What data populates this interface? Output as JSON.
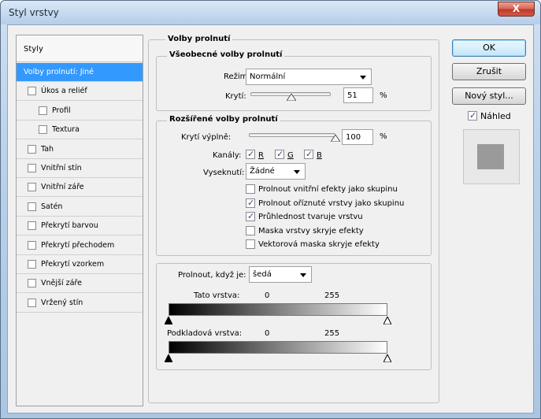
{
  "window": {
    "title": "Styl vrstvy",
    "close_label": "X"
  },
  "styles_panel": {
    "header": "Styly",
    "items": [
      {
        "label": "Volby prolnutí: Jiné",
        "checkbox": false,
        "checked": false,
        "selected": true,
        "indent": 0
      },
      {
        "label": "Úkos a reliéf",
        "checkbox": true,
        "checked": false,
        "selected": false,
        "indent": 0
      },
      {
        "label": "Profil",
        "checkbox": true,
        "checked": false,
        "selected": false,
        "indent": 1
      },
      {
        "label": "Textura",
        "checkbox": true,
        "checked": false,
        "selected": false,
        "indent": 1
      },
      {
        "label": "Tah",
        "checkbox": true,
        "checked": false,
        "selected": false,
        "indent": 0
      },
      {
        "label": "Vnitřní stín",
        "checkbox": true,
        "checked": false,
        "selected": false,
        "indent": 0
      },
      {
        "label": "Vnitřní záře",
        "checkbox": true,
        "checked": false,
        "selected": false,
        "indent": 0
      },
      {
        "label": "Satén",
        "checkbox": true,
        "checked": false,
        "selected": false,
        "indent": 0
      },
      {
        "label": "Překrytí barvou",
        "checkbox": true,
        "checked": false,
        "selected": false,
        "indent": 0
      },
      {
        "label": "Překrytí přechodem",
        "checkbox": true,
        "checked": false,
        "selected": false,
        "indent": 0
      },
      {
        "label": "Překrytí vzorkem",
        "checkbox": true,
        "checked": false,
        "selected": false,
        "indent": 0
      },
      {
        "label": "Vnější záře",
        "checkbox": true,
        "checked": false,
        "selected": false,
        "indent": 0
      },
      {
        "label": "Vržený stín",
        "checkbox": true,
        "checked": false,
        "selected": false,
        "indent": 0
      }
    ]
  },
  "blending": {
    "title": "Volby prolnutí",
    "general": {
      "title": "Všeobecné volby prolnutí",
      "mode_label": "Režim:",
      "mode_value": "Normální",
      "opacity_label": "Krytí:",
      "opacity_value": "51",
      "opacity_fraction": 0.51,
      "percent": "%"
    },
    "advanced": {
      "title": "Rozšířené volby prolnutí",
      "fill_label": "Krytí výplně:",
      "fill_value": "100",
      "fill_fraction": 1.0,
      "percent": "%",
      "channels_label": "Kanály:",
      "channel_r": "R",
      "channel_g": "G",
      "channel_b": "B",
      "knockout_label": "Vyseknutí:",
      "knockout_value": "Žádné",
      "options": [
        {
          "label": "Prolnout vnitřní efekty jako skupinu",
          "checked": false
        },
        {
          "label": "Prolnout oříznuté vrstvy jako skupinu",
          "checked": true
        },
        {
          "label": "Průhlednost tvaruje vrstvu",
          "checked": true
        },
        {
          "label": "Maska vrstvy skryje efekty",
          "checked": false
        },
        {
          "label": "Vektorová maska skryje efekty",
          "checked": false
        }
      ]
    },
    "blend_if": {
      "label": "Prolnout, když je:",
      "value": "šedá",
      "this_layer_label": "Tato vrstva:",
      "this_layer_min": "0",
      "this_layer_max": "255",
      "underlying_label": "Podkladová vrstva:",
      "underlying_min": "0",
      "underlying_max": "255"
    }
  },
  "buttons": {
    "ok": "OK",
    "cancel": "Zrušit",
    "new_style": "Nový styl...",
    "preview_label": "Náhled",
    "preview_checked": true
  }
}
